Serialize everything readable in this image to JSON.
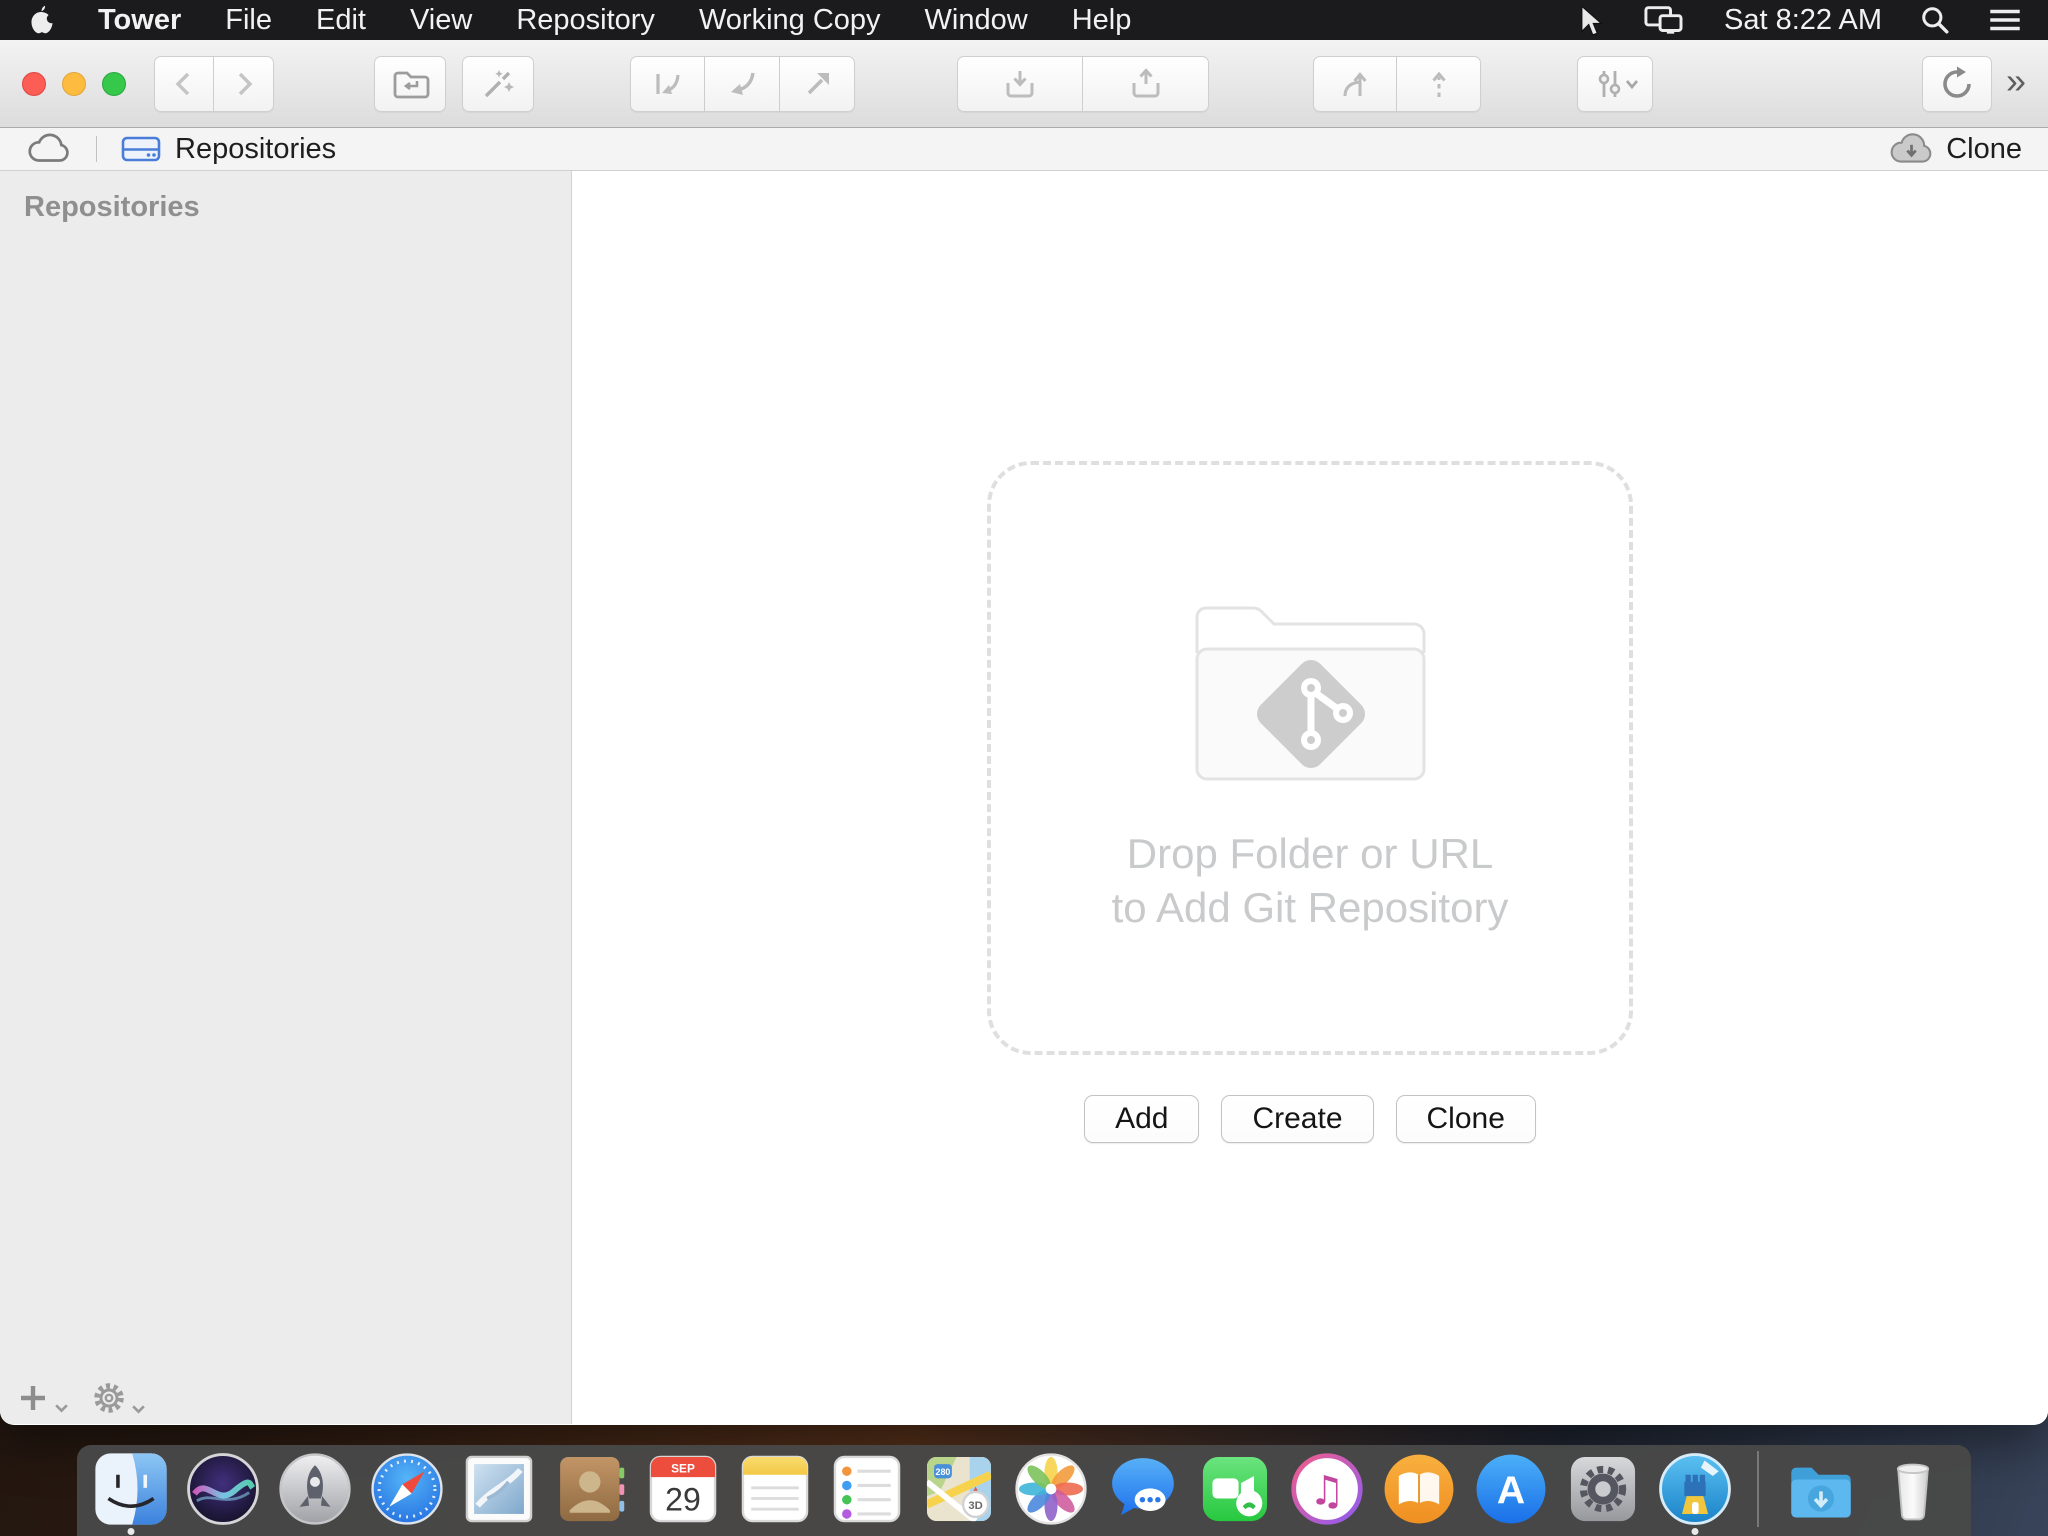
{
  "menubar": {
    "app_name": "Tower",
    "items": [
      "File",
      "Edit",
      "View",
      "Repository",
      "Working Copy",
      "Window",
      "Help"
    ],
    "status_time": "Sat 8:22 AM",
    "icons": [
      "apple-logo",
      "pointer",
      "displays",
      "spotlight",
      "notification-center"
    ]
  },
  "toolbar": {
    "icons": [
      "back",
      "forward",
      "reveal-in-finder",
      "quick-actions",
      "fetch",
      "pull",
      "push",
      "stash-save",
      "stash-apply",
      "merge",
      "rebase",
      "view-options",
      "refresh"
    ],
    "overflow_glyph": "»"
  },
  "pathbar": {
    "icons": [
      "cloud",
      "repositories-drive",
      "clone-cloud-download"
    ],
    "location_label": "Repositories",
    "clone_label": "Clone"
  },
  "sidebar": {
    "title": "Repositories",
    "footer_icons": [
      "add",
      "settings"
    ]
  },
  "main": {
    "dropzone": {
      "icon": "git-folder",
      "line1": "Drop Folder or URL",
      "line2": "to Add Git Repository"
    },
    "buttons": [
      {
        "label": "Add"
      },
      {
        "label": "Create"
      },
      {
        "label": "Clone"
      }
    ]
  },
  "dock": {
    "items": [
      "finder",
      "siri",
      "launchpad",
      "safari",
      "mail",
      "contacts",
      "calendar",
      "notes",
      "reminders",
      "maps",
      "photos",
      "messages",
      "facetime",
      "itunes",
      "ibooks",
      "app-store",
      "system-preferences",
      "tower",
      "downloads",
      "trash"
    ],
    "running": [
      "finder",
      "tower"
    ],
    "calendar_month": "SEP",
    "calendar_day": "29",
    "maps_shield": "280",
    "maps_badge": "3D"
  },
  "colors": {
    "accent_blue": "#4a7dd8",
    "menubar_bg": "#1b1b1d",
    "toolbar_icon": "#b0b0b0",
    "dock_bg": "#484848",
    "dropzone_text": "#c8cacc",
    "traffic_red": "#fc5d55",
    "traffic_yellow": "#fdbc40",
    "traffic_green": "#35c84b"
  }
}
